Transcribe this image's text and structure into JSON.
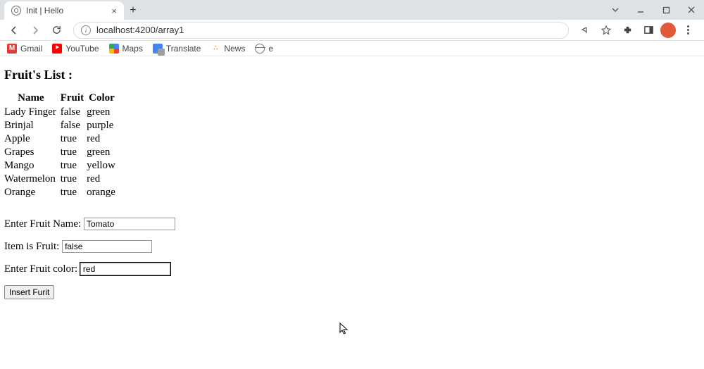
{
  "browser": {
    "tab_title": "Init | Hello",
    "url": "localhost:4200/array1",
    "bookmarks": [
      "Gmail",
      "YouTube",
      "Maps",
      "Translate",
      "News",
      "e"
    ]
  },
  "page": {
    "title": "Fruit's List :",
    "columns": [
      "Name",
      "Fruit",
      "Color"
    ],
    "rows": [
      {
        "name": "Lady Finger",
        "fruit": "false",
        "color": "green"
      },
      {
        "name": "Brinjal",
        "fruit": "false",
        "color": "purple"
      },
      {
        "name": "Apple",
        "fruit": "true",
        "color": "red"
      },
      {
        "name": "Grapes",
        "fruit": "true",
        "color": "green"
      },
      {
        "name": "Mango",
        "fruit": "true",
        "color": "yellow"
      },
      {
        "name": "Watermelon",
        "fruit": "true",
        "color": "red"
      },
      {
        "name": "Orange",
        "fruit": "true",
        "color": "orange"
      }
    ],
    "form": {
      "name_label": "Enter Fruit Name:",
      "name_value": "Tomato",
      "isfruit_label": "Item is Fruit:",
      "isfruit_value": "false",
      "color_label": "Enter Fruit color:",
      "color_value": "red",
      "button_label": "Insert Furit"
    }
  }
}
